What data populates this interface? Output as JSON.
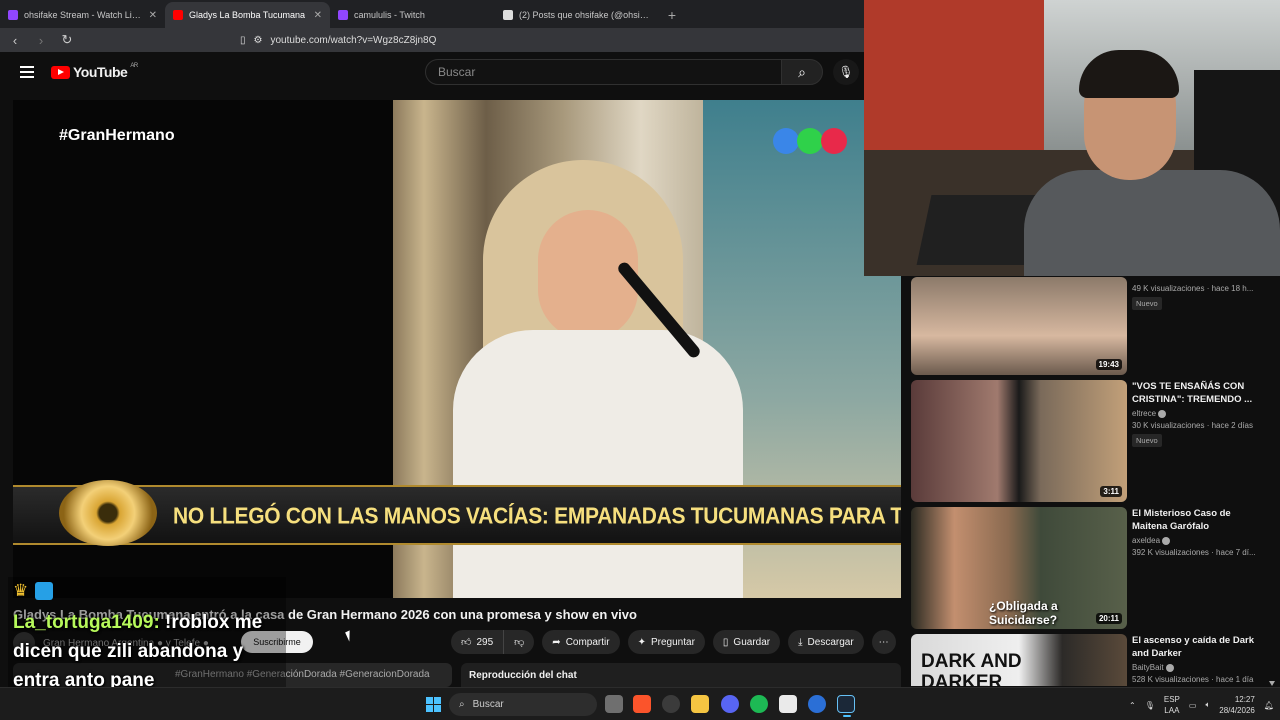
{
  "browser": {
    "tabs": [
      {
        "title": "ohsifake Stream - Watch Live on",
        "favicon_color": "#9146ff",
        "active": false
      },
      {
        "title": "Gladys La Bomba Tucumana",
        "favicon_color": "#ff0000",
        "active": true
      },
      {
        "title": "camululis - Twitch",
        "favicon_color": "#9146ff",
        "active": false
      },
      {
        "title": "(2) Posts que ohsifake (@ohsiFacu) h",
        "favicon_color": "#dddddd",
        "active": false
      }
    ],
    "url": "youtube.com/watch?v=Wgz8cZ8jn8Q"
  },
  "youtube": {
    "logo_text": "YouTube",
    "region": "AR",
    "search_placeholder": "Buscar"
  },
  "video": {
    "hashtag_overlay": "#GranHermano",
    "headline": "NO LLEGÓ CON LAS MANOS VACÍAS: EMPANADAS TUCUMANAS PARA TODOS",
    "title": "Gladys La Bomba Tucumana entró a la casa de Gran Hermano 2026 con una promesa y show en vivo",
    "channel": "Gran Hermano Argentina ● y Telefe ●",
    "subscribe_label": "Suscribirme",
    "likes": "295",
    "share_label": "Compartir",
    "ask_label": "Preguntar",
    "save_label": "Guardar",
    "download_label": "Descargar",
    "description_tags": "#GranHermano #GeneraciónDorada #GeneracionDorada",
    "chat_replay_label": "Reproducción del chat",
    "logo_dot_colors": [
      "#3a86e8",
      "#2fd14a",
      "#e8294a"
    ]
  },
  "stream_chat": {
    "username": "La_tortuga1409:",
    "message": " !roblox me dicen que zili abandona y entra anto pane"
  },
  "recommendations": [
    {
      "title": "",
      "channel": "",
      "meta": "49 K visualizaciones · hace 18 h...",
      "badge": "Nuevo",
      "duration": "19:43"
    },
    {
      "title": "\"VOS TE ENSAÑÁS CON CRISTINA\": TREMENDO ...",
      "channel": "eltrece",
      "meta": "30 K visualizaciones · hace 2 días",
      "badge": "Nuevo",
      "duration": "3:11"
    },
    {
      "title": "El Misterioso Caso de Maitena Garófalo",
      "channel": "axeldea",
      "meta": "392 K visualizaciones · hace 7 dí...",
      "badge": "",
      "duration": "20:11",
      "thumb_caption": "¿Obligada a Suicidarse?"
    },
    {
      "title": "El ascenso y caída de Dark and Darker",
      "channel": "BaityBait",
      "meta": "528 K visualizaciones · hace 1 día",
      "badge": "",
      "duration": "",
      "thumb_caption": "DARK AND DARKER"
    }
  ],
  "taskbar": {
    "search_label": "Buscar",
    "lang_top": "ESP",
    "lang_bottom": "LAA",
    "time": "12:27",
    "date": "28/4/2026"
  }
}
